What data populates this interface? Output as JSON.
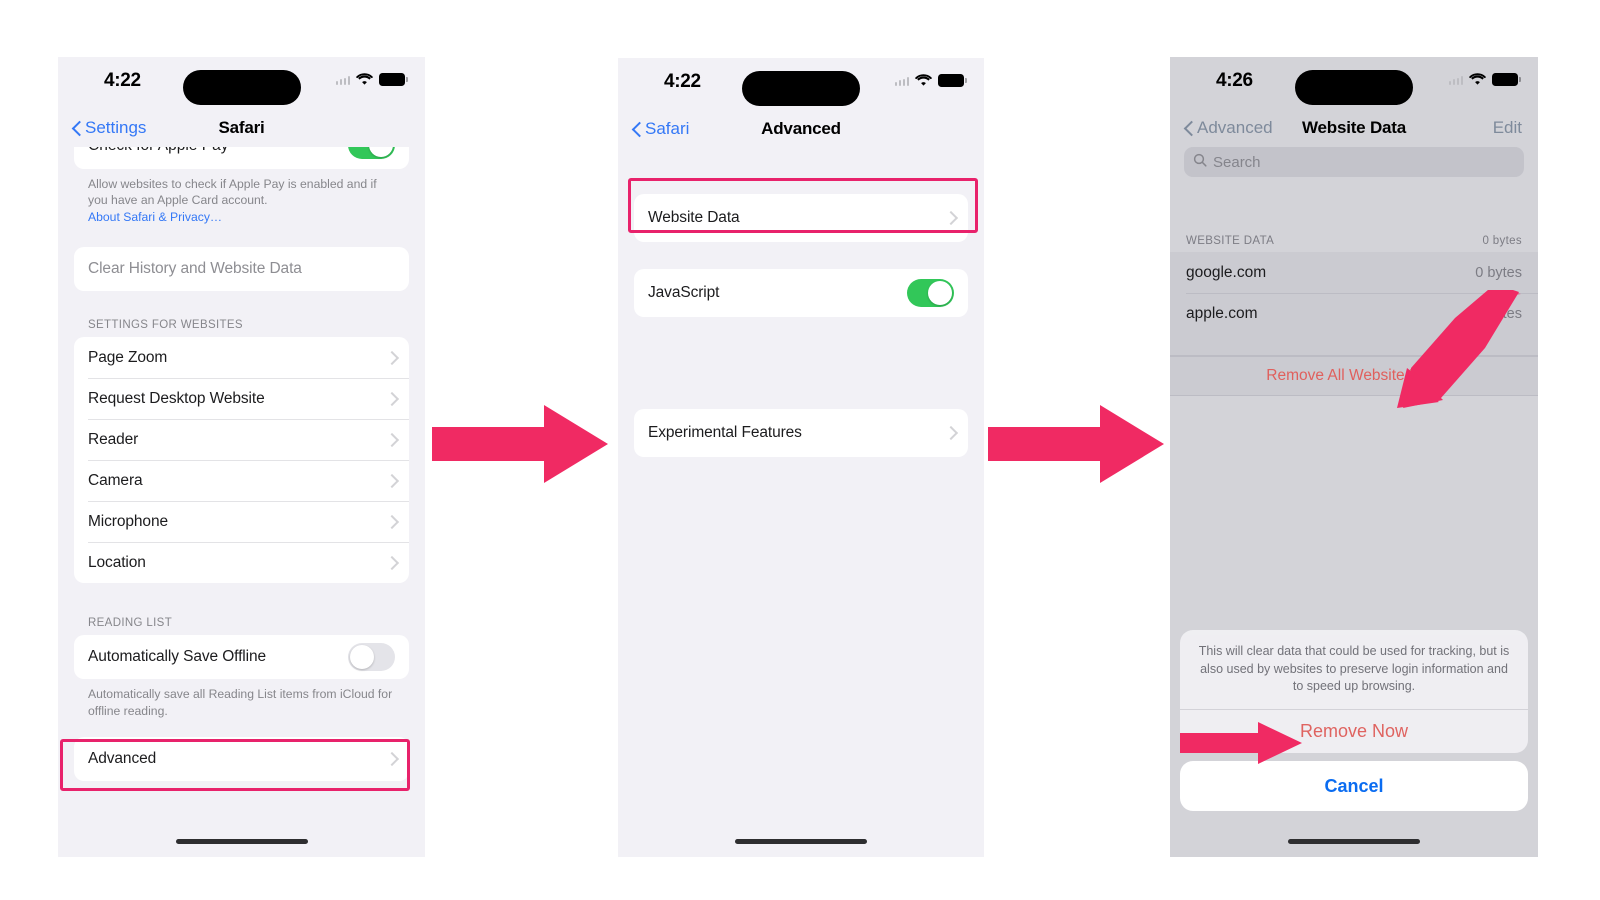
{
  "phone1": {
    "status": {
      "time": "4:22",
      "wifi_icon": "wifi-icon",
      "battery_icon": "battery-icon",
      "signal_icon": "cellular-signal-icon"
    },
    "nav": {
      "back_label": "Settings",
      "title": "Safari"
    },
    "partial_row": {
      "label": "Check for Apple Pay",
      "toggle_state": "on"
    },
    "apple_pay_note": "Allow websites to check if Apple Pay is enabled and if you have an Apple Card account.",
    "apple_pay_link": "About Safari & Privacy…",
    "clear_history_label": "Clear History and Website Data",
    "settings_for_websites_header": "SETTINGS FOR WEBSITES",
    "settings_for_websites_rows": [
      {
        "label": "Page Zoom"
      },
      {
        "label": "Request Desktop Website"
      },
      {
        "label": "Reader"
      },
      {
        "label": "Camera"
      },
      {
        "label": "Microphone"
      },
      {
        "label": "Location"
      }
    ],
    "reading_list_header": "READING LIST",
    "auto_save_row": {
      "label": "Automatically Save Offline",
      "toggle_state": "off"
    },
    "reading_list_note": "Automatically save all Reading List items from iCloud for offline reading.",
    "advanced_row": {
      "label": "Advanced"
    }
  },
  "phone2": {
    "status": {
      "time": "4:22",
      "wifi_icon": "wifi-icon",
      "battery_icon": "battery-icon",
      "signal_icon": "cellular-signal-icon"
    },
    "nav": {
      "back_label": "Safari",
      "title": "Advanced"
    },
    "website_data_row": {
      "label": "Website Data"
    },
    "javascript_row": {
      "label": "JavaScript",
      "toggle_state": "on"
    },
    "experimental_row": {
      "label": "Experimental Features"
    }
  },
  "phone3": {
    "status": {
      "time": "4:26",
      "wifi_icon": "wifi-icon",
      "battery_icon": "battery-icon",
      "signal_icon": "cellular-signal-icon"
    },
    "nav": {
      "back_label": "Advanced",
      "title": "Website Data",
      "edit_label": "Edit"
    },
    "search": {
      "placeholder": "Search",
      "icon": "search-icon"
    },
    "section_header": {
      "title": "WEBSITE DATA",
      "total": "0 bytes"
    },
    "rows": [
      {
        "site": "google.com",
        "size": "0 bytes"
      },
      {
        "site": "apple.com",
        "size": "0 bytes"
      }
    ],
    "remove_all_label": "Remove All Website Data",
    "sheet": {
      "message": "This will clear data that could be used for tracking, but is also used by websites to preserve login information and to speed up browsing.",
      "confirm_label": "Remove Now",
      "cancel_label": "Cancel"
    }
  },
  "annotations": {
    "accent_color": "#e8226b",
    "arrow1_name": "step-arrow-1",
    "arrow2_name": "step-arrow-2",
    "arrow3_name": "remove-all-pointer-arrow",
    "arrow4_name": "remove-now-pointer-arrow"
  }
}
